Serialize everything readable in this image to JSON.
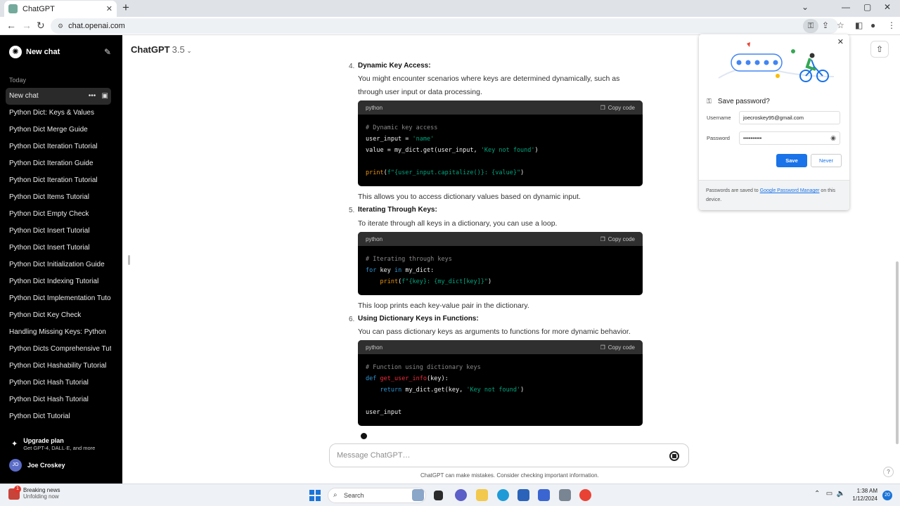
{
  "browser": {
    "tab_title": "ChatGPT",
    "url": "chat.openai.com"
  },
  "sidebar": {
    "new_chat": "New chat",
    "section": "Today",
    "active_item": "New chat",
    "items": [
      "Python Dict: Keys & Values",
      "Python Dict Merge Guide",
      "Python Dict Iteration Tutorial",
      "Python Dict Iteration Guide",
      "Python Dict Iteration Tutorial",
      "Python Dict Items Tutorial",
      "Python Dict Empty Check",
      "Python Dict Insert Tutorial",
      "Python Dict Insert Tutorial",
      "Python Dict Initialization Guide",
      "Python Dict Indexing Tutorial",
      "Python Dict Implementation Tutorial",
      "Python Dict Key Check",
      "Handling Missing Keys: Python",
      "Python Dicts Comprehensive Tutorial",
      "Python Dict Hashability Tutorial",
      "Python Dict Hash Tutorial",
      "Python Dict Hash Tutorial",
      "Python Dict Tutorial"
    ],
    "upgrade_title": "Upgrade plan",
    "upgrade_sub": "Get GPT-4, DALL·E, and more",
    "user_initials": "JO",
    "user_name": "Joe Croskey"
  },
  "main": {
    "model": "ChatGPT",
    "model_version": "3.5",
    "sections": [
      {
        "num": "4.",
        "heading": "Dynamic Key Access:",
        "intro_1": "You might encounter scenarios where keys are determined dynamically, such as",
        "intro_2": "through user input or data processing.",
        "code_lang": "python",
        "copy_label": "Copy code",
        "after": "This allows you to access dictionary values based on dynamic input."
      },
      {
        "num": "5.",
        "heading": "Iterating Through Keys:",
        "intro_1": "To iterate through all keys in a dictionary, you can use a loop.",
        "code_lang": "python",
        "copy_label": "Copy code",
        "after": "This loop prints each key-value pair in the dictionary."
      },
      {
        "num": "6.",
        "heading": "Using Dictionary Keys in Functions:",
        "intro_1": "You can pass dictionary keys as arguments to functions for more dynamic behavior.",
        "code_lang": "python",
        "copy_label": "Copy code"
      }
    ],
    "composer_placeholder": "Message ChatGPT…",
    "disclaimer": "ChatGPT can make mistakes. Consider checking important information.",
    "help": "?"
  },
  "password_popup": {
    "title": "Save password?",
    "username_label": "Username",
    "username_value": "joecroskey95@gmail.com",
    "password_label": "Password",
    "password_value": "••••••••••",
    "save": "Save",
    "never": "Never",
    "footer_1": "Passwords are saved to ",
    "footer_link": "Google Password Manager",
    "footer_2": " on this device."
  },
  "taskbar": {
    "news_title": "Breaking news",
    "news_sub": "Unfolding now",
    "news_badge": "1",
    "search": "Search",
    "time": "1:38 AM",
    "date": "1/12/2024",
    "notif_count": "20"
  },
  "colors": {
    "sidebar_bg": "#000000",
    "accent": "#1a73e8",
    "code_bg": "#000000",
    "code_head_bg": "#2f2f2f"
  },
  "icons": [
    "chatgpt-logo-icon",
    "edit-icon",
    "share-icon",
    "key-icon",
    "copy-icon",
    "stop-icon",
    "eye-icon",
    "close-icon",
    "windows-start-icon",
    "search-icon"
  ]
}
